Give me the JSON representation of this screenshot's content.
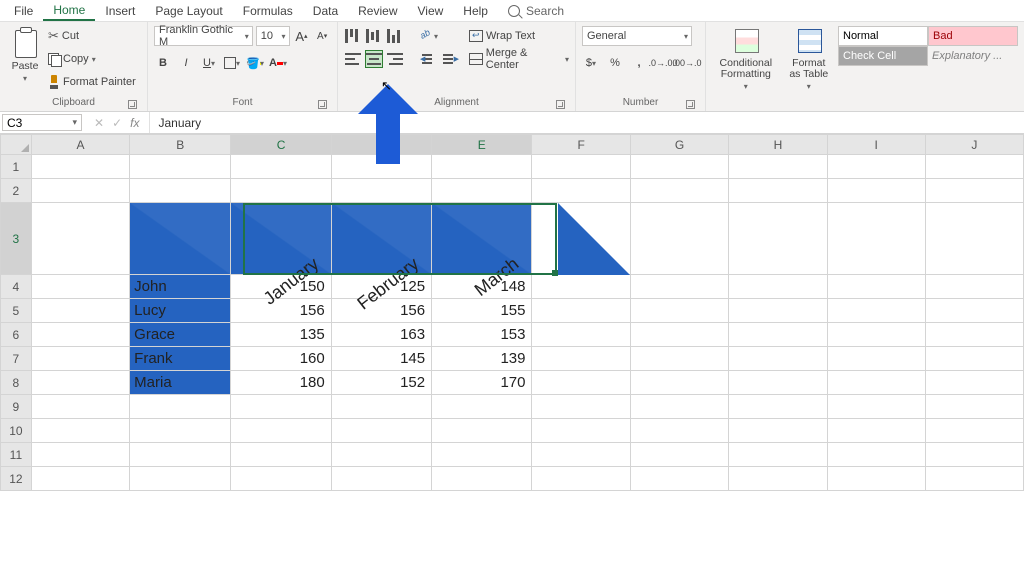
{
  "menu": {
    "file": "File",
    "home": "Home",
    "insert": "Insert",
    "page_layout": "Page Layout",
    "formulas": "Formulas",
    "data": "Data",
    "review": "Review",
    "view": "View",
    "help": "Help",
    "search": "Search"
  },
  "ribbon": {
    "clipboard": {
      "title": "Clipboard",
      "paste": "Paste",
      "cut": "Cut",
      "copy": "Copy",
      "painter": "Format Painter"
    },
    "font": {
      "title": "Font",
      "name": "Franklin Gothic M",
      "size": "10",
      "bold": "B",
      "italic": "I",
      "underline": "U",
      "grow": "A",
      "shrink": "A"
    },
    "alignment": {
      "title": "Alignment",
      "wrap": "Wrap Text",
      "merge": "Merge & Center"
    },
    "number": {
      "title": "Number",
      "format": "General",
      "currency": "$",
      "percent": "%",
      "comma": ","
    },
    "styles": {
      "cond": "Conditional Formatting",
      "fat": "Format as Table",
      "normal": "Normal",
      "bad": "Bad",
      "check": "Check Cell",
      "explan": "Explanatory ..."
    }
  },
  "namebox": "C3",
  "formula": "January",
  "columns": [
    "A",
    "B",
    "C",
    "D",
    "E",
    "F",
    "G",
    "H",
    "I",
    "J"
  ],
  "row_numbers": [
    "1",
    "2",
    "3",
    "4",
    "5",
    "6",
    "7",
    "8",
    "9",
    "10",
    "11",
    "12"
  ],
  "chart_data": {
    "type": "table",
    "months": [
      "January",
      "February",
      "March"
    ],
    "rows": [
      {
        "name": "John",
        "values": [
          150,
          125,
          148
        ]
      },
      {
        "name": "Lucy",
        "values": [
          156,
          156,
          155
        ]
      },
      {
        "name": "Grace",
        "values": [
          135,
          163,
          153
        ]
      },
      {
        "name": "Frank",
        "values": [
          160,
          145,
          139
        ]
      },
      {
        "name": "Maria",
        "values": [
          180,
          152,
          170
        ]
      }
    ]
  }
}
